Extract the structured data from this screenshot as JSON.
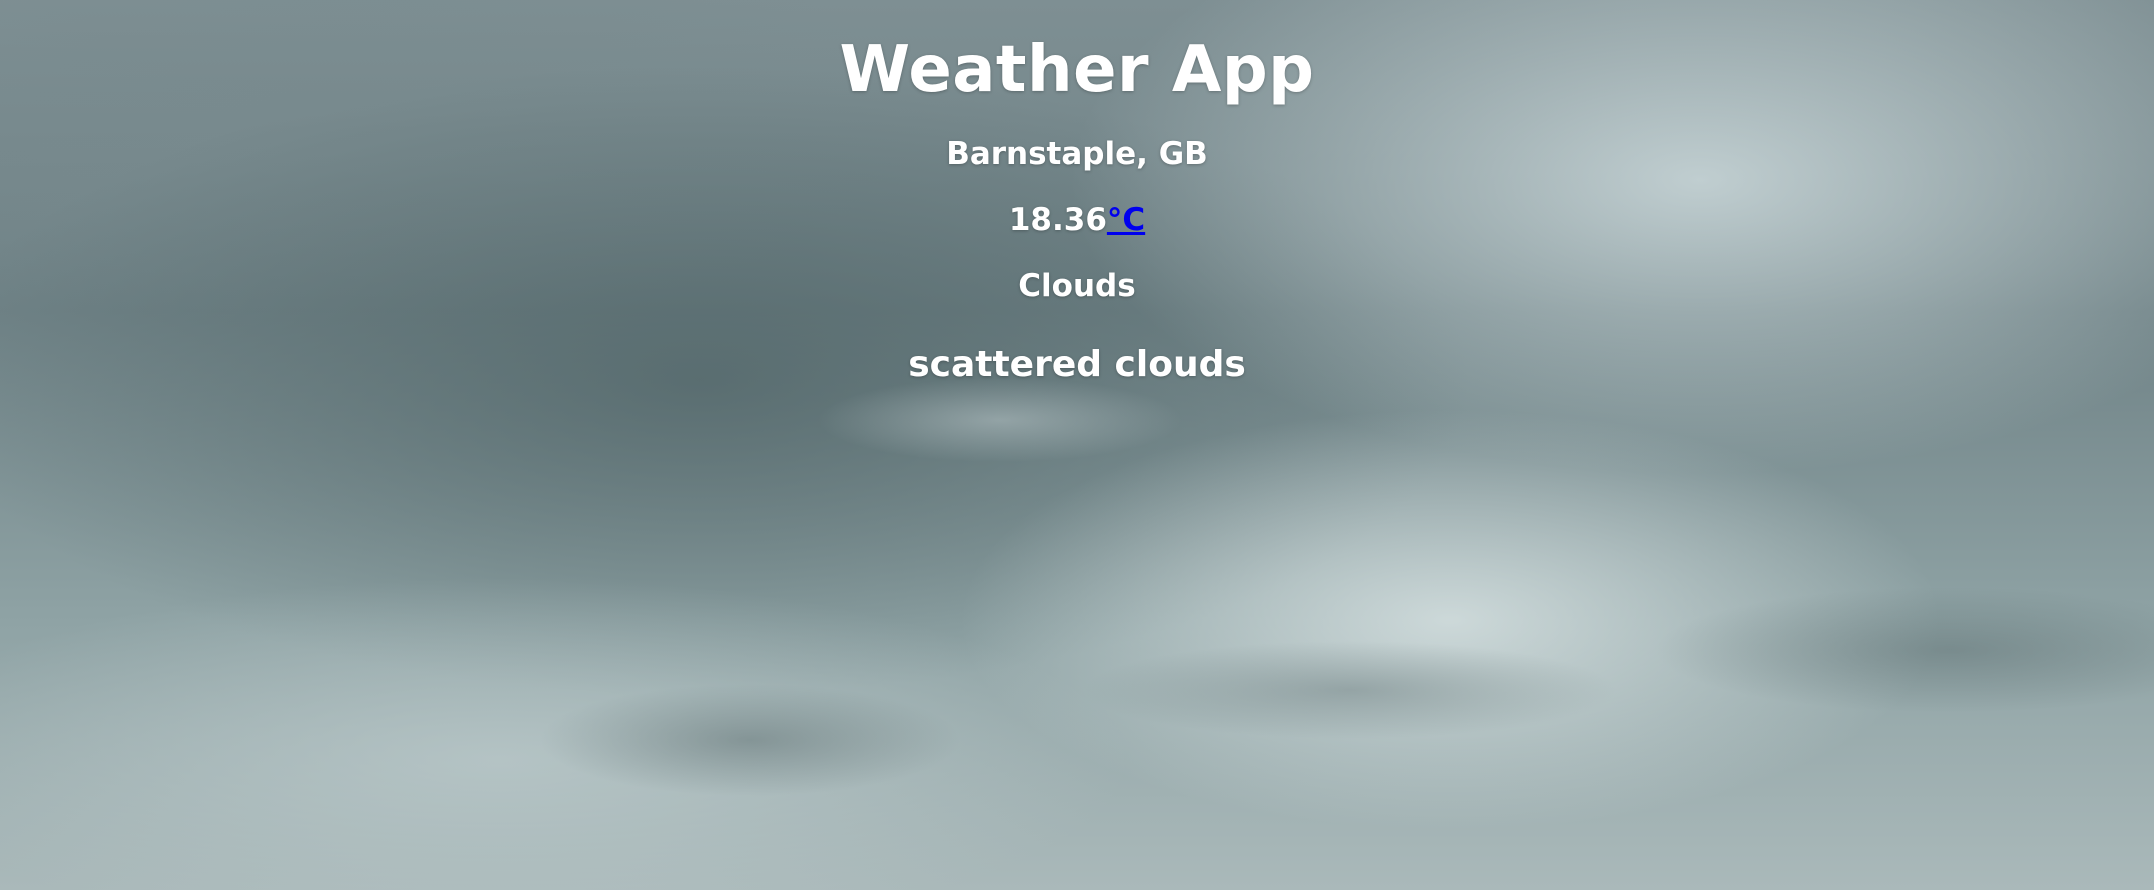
{
  "app": {
    "title": "Weather App"
  },
  "weather": {
    "location": "Barnstaple, GB",
    "temperature": "18.36",
    "unit_label": "°C",
    "condition": "Clouds",
    "description": "scattered clouds"
  },
  "colors": {
    "text": "#ffffff",
    "unit_link": "#0000ee",
    "sky_dark": "#6f8286",
    "sky_light": "#cddadc"
  }
}
